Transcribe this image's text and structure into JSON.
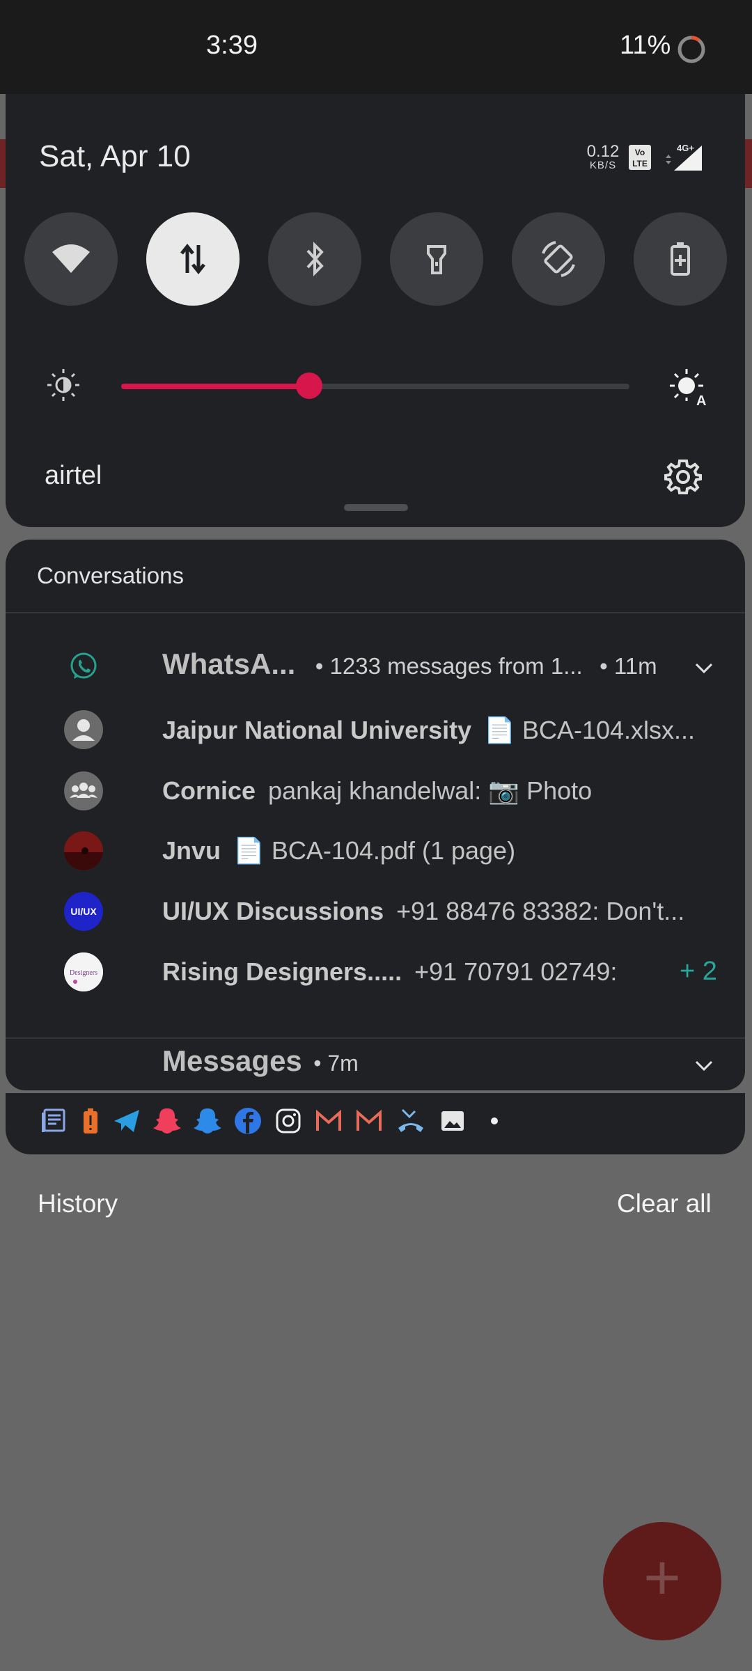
{
  "status_bar": {
    "time": "3:39",
    "battery_text": "11%",
    "battery_level": 0.11
  },
  "quick_settings": {
    "date": "Sat, Apr 10",
    "net_speed_value": "0.12",
    "net_speed_unit": "KB/S",
    "volte_label": "Vo LTE",
    "network_type": "4G+",
    "tiles": [
      {
        "name": "wifi",
        "active": false
      },
      {
        "name": "mobile-data",
        "active": true
      },
      {
        "name": "bluetooth",
        "active": false
      },
      {
        "name": "flashlight",
        "active": false
      },
      {
        "name": "auto-rotate",
        "active": false
      },
      {
        "name": "battery-saver",
        "active": false
      }
    ],
    "brightness_level": 0.37,
    "carrier": "airtel",
    "accent_color": "#d7174c"
  },
  "conversations": {
    "header": "Conversations",
    "whatsapp": {
      "app_name": "WhatsA...",
      "summary": "• 1233 messages from 1...",
      "time": "• 11m"
    },
    "items": [
      {
        "sender": "Jaipur National University",
        "body": "📄 BCA-104.xlsx..."
      },
      {
        "sender": "Cornice",
        "body": "pankaj khandelwal: 📷 Photo"
      },
      {
        "sender": "Jnvu",
        "body": "📄 BCA-104.pdf (1 page)"
      },
      {
        "sender": "UI/UX Discussions",
        "body": "+91 88476 83382: Don't..."
      },
      {
        "sender": "Rising Designers.....",
        "body": "+91 70791 02749:",
        "extra": "+ 2"
      }
    ],
    "avatar_labels": {
      "uiux": "UI/UX",
      "rising": "Designers"
    },
    "messages": {
      "app_name": "Messages",
      "time": "• 7m"
    }
  },
  "app_strip": {
    "icons": [
      "news-icon",
      "battery-alert-icon",
      "telegram-icon",
      "snapchat-red-icon",
      "snapchat-blue-icon",
      "facebook-icon",
      "instagram-icon",
      "gmail-icon",
      "gmail-icon",
      "missed-call-icon",
      "gallery-icon",
      "more-dot-icon"
    ]
  },
  "footer": {
    "history": "History",
    "clear_all": "Clear all"
  },
  "fab": {
    "label": "+"
  }
}
